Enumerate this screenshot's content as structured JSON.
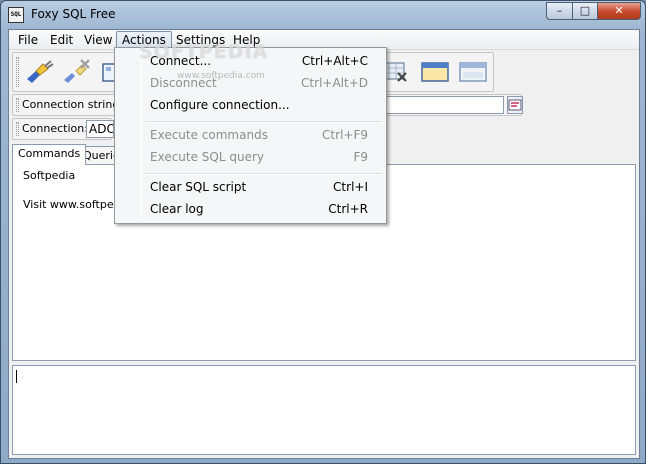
{
  "window": {
    "title": "Foxy SQL Free",
    "app_icon_text": "SQL",
    "buttons": {
      "minimize": "–",
      "maximize": "□",
      "close": "✕"
    }
  },
  "menubar": {
    "items": [
      {
        "label": "File"
      },
      {
        "label": "Edit"
      },
      {
        "label": "View"
      },
      {
        "label": "Actions",
        "open": true
      },
      {
        "label": "Settings"
      },
      {
        "label": "Help"
      }
    ]
  },
  "toolbar": {
    "icons": [
      "connect-plug-icon",
      "disconnect-plug-icon",
      "configure-icon",
      "clear-grid-icon",
      "window-icon",
      "window-split-icon"
    ]
  },
  "connection": {
    "string_label": "Connection string:",
    "string_value": "",
    "type_label": "Connection:",
    "type_value": "ADO"
  },
  "tabs": [
    {
      "label": "Commands",
      "active": true
    },
    {
      "label": "Queries",
      "active": false
    }
  ],
  "log": {
    "lines": [
      "Softpedia",
      "Visit www.softpedia.com"
    ]
  },
  "actions_menu": {
    "items": [
      {
        "label": "Connect...",
        "shortcut": "Ctrl+Alt+C",
        "enabled": true
      },
      {
        "label": "Disconnect",
        "shortcut": "Ctrl+Alt+D",
        "enabled": false
      },
      {
        "label": "Configure connection...",
        "shortcut": "",
        "enabled": true
      },
      {
        "label": "Execute commands",
        "shortcut": "Ctrl+F9",
        "enabled": false
      },
      {
        "label": "Execute SQL query",
        "shortcut": "F9",
        "enabled": false
      },
      {
        "label": "Clear SQL script",
        "shortcut": "Ctrl+I",
        "enabled": true
      },
      {
        "label": "Clear log",
        "shortcut": "Ctrl+R",
        "enabled": true
      }
    ]
  },
  "watermark": {
    "text": "SOFTPEDIA",
    "sub": "www.softpedia.com"
  },
  "colors": {
    "accent": "#7a8fa8",
    "close_button": "#c7482a",
    "disabled_text": "#8d8d8d"
  }
}
